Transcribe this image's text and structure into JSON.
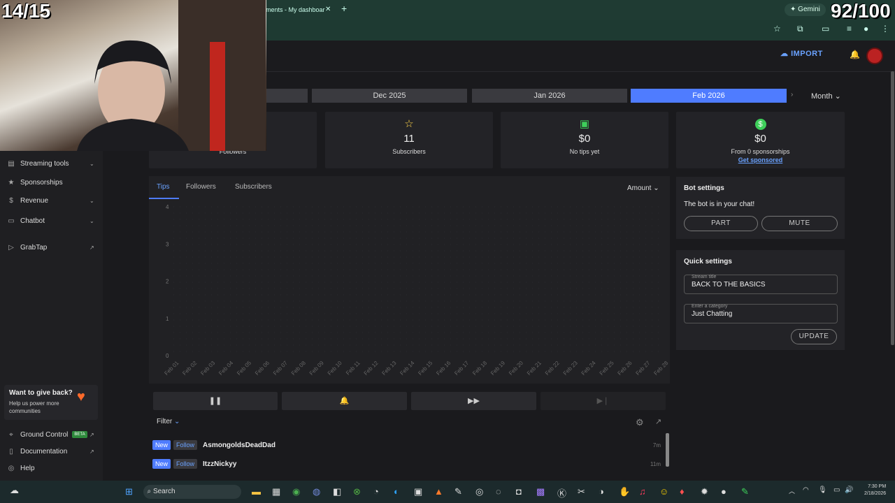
{
  "overlay": {
    "left_counter": "14/15",
    "right_counter": "92/100"
  },
  "browser": {
    "tab_title": "ments - My dashboar",
    "tab_close": "✕",
    "new_tab": "+",
    "gemini_label": "Gemini"
  },
  "header": {
    "import_label": "IMPORT"
  },
  "months": {
    "dec": "Dec 2025",
    "jan": "Jan 2026",
    "feb": "Feb 2026",
    "period": "Month"
  },
  "stats": {
    "followers_label": "Followers",
    "subscribers_value": "11",
    "subscribers_label": "Subscribers",
    "tips_value": "$0",
    "tips_label": "No tips yet",
    "spons_value": "$0",
    "spons_label": "From 0 sponsorships",
    "spons_link": "Get sponsored"
  },
  "sidebar": {
    "items": [
      {
        "label": "Streaming tools"
      },
      {
        "label": "Sponsorships"
      },
      {
        "label": "Revenue"
      },
      {
        "label": "Chatbot"
      },
      {
        "label": "GrabTap"
      }
    ],
    "giveback_title": "Want to give back?",
    "giveback_text": "Help us power more communities",
    "bottom": [
      {
        "label": "Ground Control",
        "badge": "BETA"
      },
      {
        "label": "Documentation"
      },
      {
        "label": "Help"
      }
    ]
  },
  "chart_tabs": {
    "tips": "Tips",
    "followers": "Followers",
    "subscribers": "Subscribers",
    "amount": "Amount"
  },
  "chart_data": {
    "type": "line",
    "y_ticks": [
      "4",
      "3",
      "2",
      "1",
      "0"
    ],
    "ylim": [
      0,
      4
    ],
    "categories": [
      "Feb 01",
      "Feb 02",
      "Feb 03",
      "Feb 04",
      "Feb 05",
      "Feb 06",
      "Feb 07",
      "Feb 08",
      "Feb 09",
      "Feb 10",
      "Feb 11",
      "Feb 12",
      "Feb 13",
      "Feb 14",
      "Feb 15",
      "Feb 16",
      "Feb 17",
      "Feb 18",
      "Feb 19",
      "Feb 20",
      "Feb 21",
      "Feb 22",
      "Feb 23",
      "Feb 24",
      "Feb 25",
      "Feb 26",
      "Feb 27",
      "Feb 28"
    ],
    "series": [],
    "grid": true
  },
  "feed": {
    "filter_label": "Filter",
    "events": [
      {
        "badge": "New",
        "type": "Follow",
        "name": "AsmongoldsDeadDad",
        "time": "7m"
      },
      {
        "badge": "New",
        "type": "Follow",
        "name": "ItzzNickyy",
        "time": "11m"
      }
    ]
  },
  "bot": {
    "title": "Bot settings",
    "status": "The bot is in your chat!",
    "part": "PART",
    "mute": "MUTE"
  },
  "quick": {
    "title": "Quick settings",
    "stream_title_label": "Stream title",
    "stream_title_value": "BACK TO THE BASICS",
    "category_label": "Enter a category",
    "category_value": "Just Chatting",
    "update": "UPDATE"
  },
  "taskbar": {
    "search": "Search",
    "time": "7:30 PM",
    "date": "2/18/2026"
  },
  "colors": {
    "accent": "#4f7cff",
    "link": "#6aa2ff",
    "bg": "#1a1a1d"
  }
}
